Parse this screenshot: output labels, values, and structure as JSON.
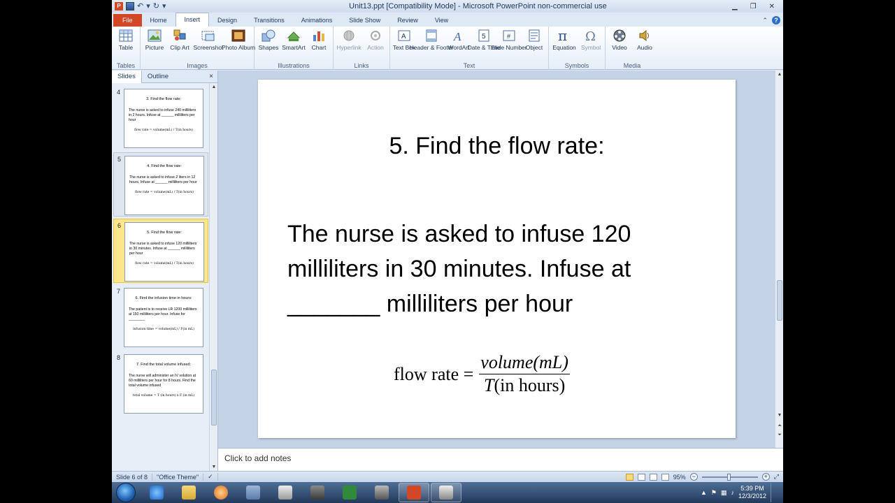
{
  "window": {
    "title": "Unit13.ppt [Compatibility Mode] - Microsoft PowerPoint non-commercial use",
    "app_icon": "P"
  },
  "tabs": [
    "File",
    "Home",
    "Insert",
    "Design",
    "Transitions",
    "Animations",
    "Slide Show",
    "Review",
    "View"
  ],
  "active_tab": "Insert",
  "ribbon": {
    "groups": {
      "tables": {
        "label": "Tables",
        "table": "Table"
      },
      "images": {
        "label": "Images",
        "picture": "Picture",
        "clip_art": "Clip Art",
        "screenshot": "Screenshot",
        "photo_album": "Photo Album"
      },
      "illustrations": {
        "label": "Illustrations",
        "shapes": "Shapes",
        "smartart": "SmartArt",
        "chart": "Chart"
      },
      "links": {
        "label": "Links",
        "hyperlink": "Hyperlink",
        "action": "Action"
      },
      "text": {
        "label": "Text",
        "text_box": "Text Box",
        "header_footer": "Header & Footer",
        "wordart": "WordArt",
        "date_time": "Date & Time",
        "slide_number": "Slide Number",
        "object": "Object"
      },
      "symbols": {
        "label": "Symbols",
        "equation": "Equation",
        "symbol": "Symbol"
      },
      "media": {
        "label": "Media",
        "video": "Video",
        "audio": "Audio"
      }
    }
  },
  "pane": {
    "tab_slides": "Slides",
    "tab_outline": "Outline",
    "close": "×",
    "thumbnails": [
      {
        "num": "4",
        "title": "3.  Find the flow rate:",
        "body": "The nurse is asked to infuse 240 milliliters in 2 hours.  Infuse at ______ milliliters  per hour",
        "formula": "flow rate = volume(mL) / T(in hours)"
      },
      {
        "num": "5",
        "title": "4.  Find the flow rate:",
        "body": "The nurse is asked to infuse 2 liters in 12 hours.  Infuse at ______ milliliters per hour",
        "formula": "flow rate = volume(mL) / T(in hours)"
      },
      {
        "num": "6",
        "title": "5.  Find the flow rate:",
        "body": "The nurse is asked to infuse 120 milliliters in 30 minutes.  Infuse at ______ milliliters  per hour",
        "formula": "flow rate = volume(mL) / T(in hours)"
      },
      {
        "num": "7",
        "title": "6.  Find the infusion time in hours:",
        "body": "The patient is to receive LR 1200 milliliters at 150 milliliters per hour. Infuse for ________",
        "formula": "infusion time = volume(mL) / F(in mL)"
      },
      {
        "num": "8",
        "title": "7.  Find the total volume infused:",
        "body": "The nurse will administer an IV solution at 60 milliliters per hour for 8 hours.  Find the total volume infused",
        "formula": "total volume = T (in hours) x F (in mL)"
      }
    ]
  },
  "slide": {
    "title": "5.  Find the flow rate:",
    "body_line1": "The nurse is asked to infuse 120",
    "body_line2": "milliliters in 30 minutes.  Infuse at",
    "body_line3": "_______ milliliters per hour",
    "formula_lhs": "flow rate =",
    "formula_num": "volume(mL)",
    "formula_den_var": "T",
    "formula_den_rest": "(in hours)"
  },
  "notes": {
    "placeholder": "Click to add notes"
  },
  "status": {
    "slide_info": "Slide 6 of 8",
    "theme": "\"Office Theme\"",
    "zoom": "95%",
    "zoom_level": 0.95
  },
  "taskbar": {
    "time": "5:39 PM",
    "date": "12/3/2012"
  },
  "colors": {
    "file_tab": "#d24726",
    "selected_thumb": "#fde68c",
    "ribbon_bg": "#dfe9f5"
  }
}
